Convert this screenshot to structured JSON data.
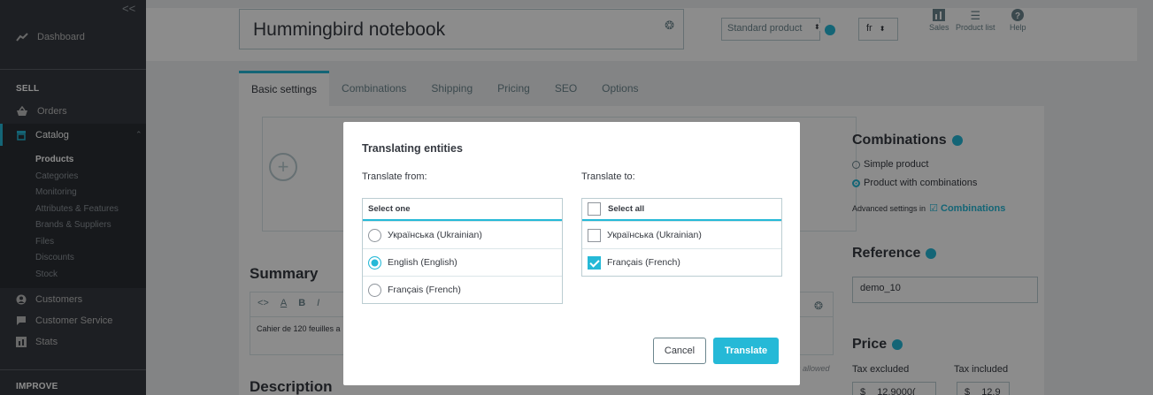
{
  "sidebar": {
    "collapse_glyph": "<<",
    "dashboard": "Dashboard",
    "sell_section": "SELL",
    "orders": "Orders",
    "catalog": "Catalog",
    "catalog_sub": [
      "Products",
      "Categories",
      "Monitoring",
      "Attributes & Features",
      "Brands & Suppliers",
      "Files",
      "Discounts",
      "Stock"
    ],
    "customers": "Customers",
    "customer_service": "Customer Service",
    "stats": "Stats",
    "improve_section": "IMPROVE"
  },
  "header": {
    "product_name": "Hummingbird notebook",
    "product_type": "Standard product",
    "language": "fr",
    "sales": "Sales",
    "product_list": "Product list",
    "help": "Help"
  },
  "tabs": [
    "Basic settings",
    "Combinations",
    "Shipping",
    "Pricing",
    "SEO",
    "Options"
  ],
  "main": {
    "summary_title": "Summary",
    "summary_text": "Cahier de 120 feuilles a",
    "description_title": "Description",
    "chars_note": "s allowed"
  },
  "right": {
    "combinations_title": "Combinations",
    "simple_product": "Simple product",
    "product_with_combinations": "Product with combinations",
    "advanced_settings_prefix": "Advanced settings in",
    "advanced_settings_link": "Combinations",
    "reference_title": "Reference",
    "reference_value": "demo_10",
    "price_title": "Price",
    "tax_excluded": "Tax excluded",
    "tax_included": "Tax included",
    "currency": "$",
    "price_excl": "12.9000(",
    "price_incl": "12.9"
  },
  "modal": {
    "title": "Translating entities",
    "translate_from": "Translate from:",
    "translate_to": "Translate to:",
    "select_one": "Select one",
    "select_all": "Select all",
    "from_options": [
      {
        "label": "Українська (Ukrainian)",
        "selected": false
      },
      {
        "label": "English (English)",
        "selected": true
      },
      {
        "label": "Français (French)",
        "selected": false
      }
    ],
    "to_options": [
      {
        "label": "Українська (Ukrainian)",
        "checked": false
      },
      {
        "label": "Français (French)",
        "checked": true
      }
    ],
    "cancel": "Cancel",
    "translate": "Translate"
  },
  "colors": {
    "accent": "#25b9d7",
    "sidebar": "#363a41"
  }
}
